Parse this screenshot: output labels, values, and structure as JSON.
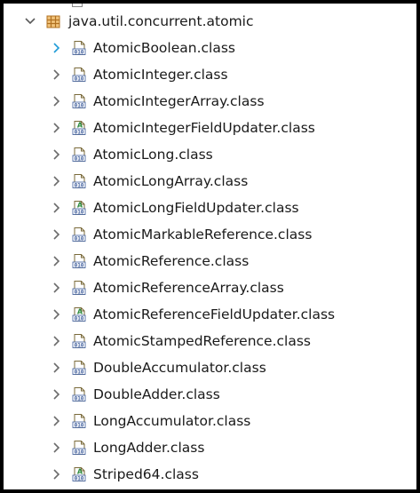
{
  "tree": {
    "package": {
      "label": "java.util.concurrent.atomic",
      "icon": "package-icon",
      "expanded": true
    },
    "classes": [
      {
        "label": "AtomicBoolean.class",
        "icon": "class-file-icon",
        "selected": true
      },
      {
        "label": "AtomicInteger.class",
        "icon": "class-file-icon"
      },
      {
        "label": "AtomicIntegerArray.class",
        "icon": "class-file-icon"
      },
      {
        "label": "AtomicIntegerFieldUpdater.class",
        "icon": "abstract-class-file-icon"
      },
      {
        "label": "AtomicLong.class",
        "icon": "class-file-icon"
      },
      {
        "label": "AtomicLongArray.class",
        "icon": "class-file-icon"
      },
      {
        "label": "AtomicLongFieldUpdater.class",
        "icon": "abstract-class-file-icon"
      },
      {
        "label": "AtomicMarkableReference.class",
        "icon": "class-file-icon"
      },
      {
        "label": "AtomicReference.class",
        "icon": "class-file-icon"
      },
      {
        "label": "AtomicReferenceArray.class",
        "icon": "class-file-icon"
      },
      {
        "label": "AtomicReferenceFieldUpdater.class",
        "icon": "abstract-class-file-icon"
      },
      {
        "label": "AtomicStampedReference.class",
        "icon": "class-file-icon"
      },
      {
        "label": "DoubleAccumulator.class",
        "icon": "class-file-icon"
      },
      {
        "label": "DoubleAdder.class",
        "icon": "class-file-icon"
      },
      {
        "label": "LongAccumulator.class",
        "icon": "class-file-icon"
      },
      {
        "label": "LongAdder.class",
        "icon": "class-file-icon"
      },
      {
        "label": "Striped64.class",
        "icon": "abstract-class-file-icon"
      }
    ]
  },
  "colors": {
    "chevron": "#6b6b6b",
    "chevron_selected": "#1e9bd7",
    "package_icon": "#c8862e",
    "class_icon_border": "#7a6a3a",
    "class_icon_fill": "#ffffff",
    "class_icon_bits": "#3a5a9a",
    "abstract_marker": "#2e8b3e"
  }
}
